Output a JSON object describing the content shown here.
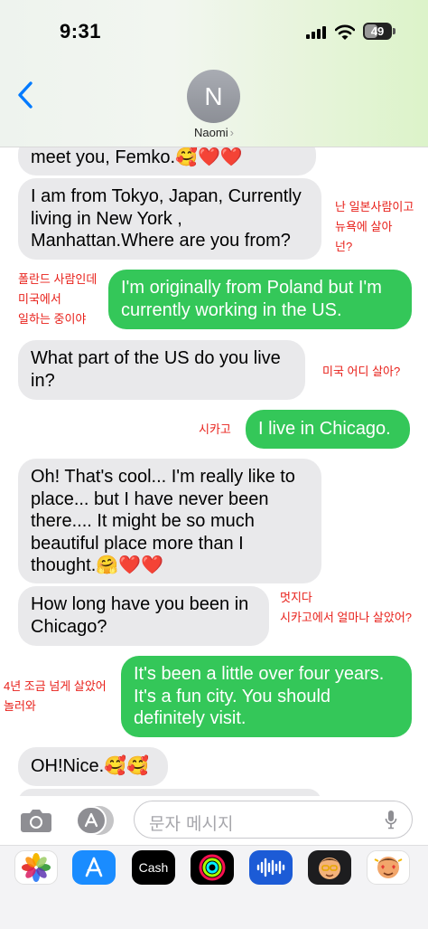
{
  "status": {
    "time": "9:31",
    "battery": "49"
  },
  "header": {
    "avatar_initial": "N",
    "contact_name": "Naomi",
    "chevron": "›"
  },
  "messages": [
    {
      "text": "meet you, Femko.🥰❤️❤️"
    },
    {
      "text": "I am from Tokyo, Japan, Currently living in New York , Manhattan.Where are you from?"
    },
    {
      "text": "I'm originally from Poland but I'm currently working in the US."
    },
    {
      "text": "What part of the US do you live in?"
    },
    {
      "text": "I live in Chicago."
    },
    {
      "text": "Oh! That's cool... I'm really like to place... but I have never been there.... It might be so much beautiful place more than I thought.🤗❤️❤️"
    },
    {
      "text": "How long have you been in Chicago?"
    },
    {
      "text": "It's been a little over four years. It's a fun city. You should definitely visit."
    },
    {
      "text": "OH!Nice.🥰🥰"
    }
  ],
  "annotations": [
    {
      "text": "난 일본사람이고\n뉴욕에 살아\n넌?"
    },
    {
      "text": "폴란드 사람인데\n미국에서\n일하는 중이야"
    },
    {
      "text": "미국 어디 살아?"
    },
    {
      "text": "시카고"
    },
    {
      "text": "멋지다\n시카고에서 얼마나 살았어?"
    },
    {
      "text": "4년 조금 넘게 살았어\n놀러와"
    }
  ],
  "input": {
    "placeholder": "문자 메시지"
  },
  "dock": {
    "apps": [
      {
        "name": "photos-icon"
      },
      {
        "name": "app-store-icon"
      },
      {
        "name": "apple-cash-icon",
        "label": "Cash"
      },
      {
        "name": "fitness-icon"
      },
      {
        "name": "audio-message-icon"
      },
      {
        "name": "memoji-icon"
      },
      {
        "name": "memoji-stickers-icon"
      }
    ]
  },
  "colors": {
    "incoming_bubble": "#e9e9eb",
    "outgoing_bubble": "#34c759",
    "annotation": "#e8201a",
    "link_blue": "#007aff"
  }
}
